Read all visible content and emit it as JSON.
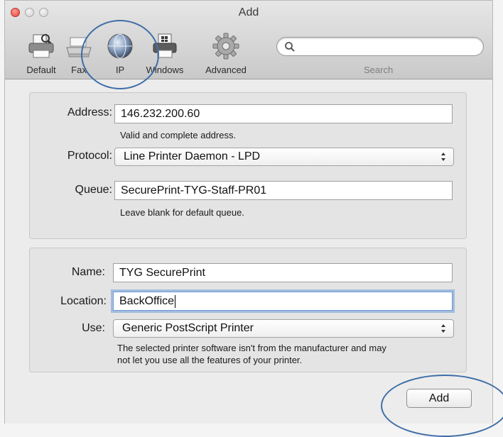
{
  "window": {
    "title": "Add"
  },
  "toolbar": {
    "items": [
      {
        "label": "Default",
        "icon": "printer-icon"
      },
      {
        "label": "Fax",
        "icon": "fax-icon"
      },
      {
        "label": "IP",
        "icon": "globe-icon",
        "selected": true
      },
      {
        "label": "Windows",
        "icon": "windows-printer-icon"
      },
      {
        "label": "Advanced",
        "icon": "gear-icon"
      }
    ],
    "search": {
      "placeholder": "",
      "label": "Search"
    }
  },
  "ip_group": {
    "address_label": "Address:",
    "address_value": "146.232.200.60",
    "address_hint": "Valid and complete address.",
    "protocol_label": "Protocol:",
    "protocol_value": "Line Printer Daemon - LPD",
    "queue_label": "Queue:",
    "queue_value": "SecurePrint-TYG-Staff-PR01",
    "queue_hint": "Leave blank for default queue."
  },
  "details_group": {
    "name_label": "Name:",
    "name_value": "TYG SecurePrint",
    "location_label": "Location:",
    "location_value": "BackOffice",
    "use_label": "Use:",
    "use_value": "Generic PostScript Printer",
    "warning_line1": "The selected printer software isn't from the manufacturer and may",
    "warning_line2": "not let you use all the features of your printer."
  },
  "footer": {
    "add_label": "Add"
  },
  "colors": {
    "annotation": "#3e6ea7",
    "focus_ring": "#6d9bd9",
    "close": "#e0443e"
  }
}
